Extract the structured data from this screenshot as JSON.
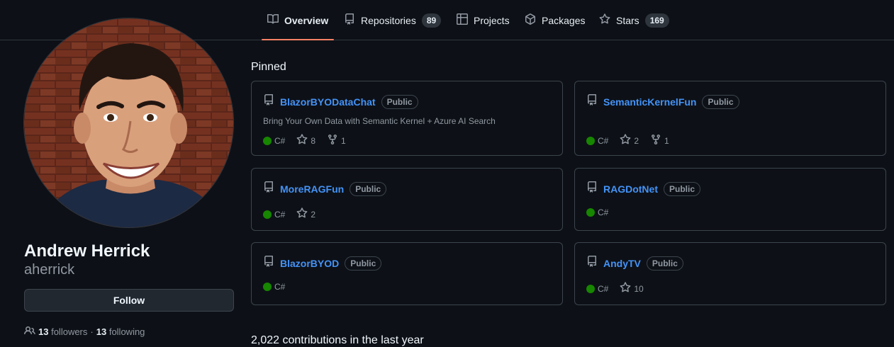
{
  "nav": {
    "tabs": [
      {
        "label": "Overview",
        "count": null,
        "icon": "book-icon"
      },
      {
        "label": "Repositories",
        "count": "89",
        "icon": "repo-icon"
      },
      {
        "label": "Projects",
        "count": null,
        "icon": "table-icon"
      },
      {
        "label": "Packages",
        "count": null,
        "icon": "package-icon"
      },
      {
        "label": "Stars",
        "count": "169",
        "icon": "star-icon"
      }
    ],
    "selected": "Overview",
    "accent_color": "#f78166"
  },
  "profile": {
    "display_name": "Andrew Herrick",
    "username": "aherrick",
    "follow_label": "Follow",
    "followers_count": "13",
    "followers_label": "followers",
    "separator": "·",
    "following_count": "13",
    "following_label": "following"
  },
  "pinned": {
    "title": "Pinned",
    "cards": [
      {
        "name": "BlazorBYODataChat",
        "visibility": "Public",
        "description": "Bring Your Own Data with Semantic Kernel + Azure AI Search",
        "language": "C#",
        "stars": "8",
        "forks": "1"
      },
      {
        "name": "SemanticKernelFun",
        "visibility": "Public",
        "description": "",
        "language": "C#",
        "stars": "2",
        "forks": "1"
      },
      {
        "name": "MoreRAGFun",
        "visibility": "Public",
        "description": "",
        "language": "C#",
        "stars": "2",
        "forks": ""
      },
      {
        "name": "RAGDotNet",
        "visibility": "Public",
        "description": "",
        "language": "C#",
        "stars": "",
        "forks": ""
      },
      {
        "name": "BlazorBYOD",
        "visibility": "Public",
        "description": "",
        "language": "C#",
        "stars": "",
        "forks": ""
      },
      {
        "name": "AndyTV",
        "visibility": "Public",
        "description": "",
        "language": "C#",
        "stars": "10",
        "forks": ""
      }
    ],
    "language_color": "#178600",
    "link_color": "#4493f8"
  },
  "contributions": {
    "heading": "2,022 contributions in the last year"
  }
}
